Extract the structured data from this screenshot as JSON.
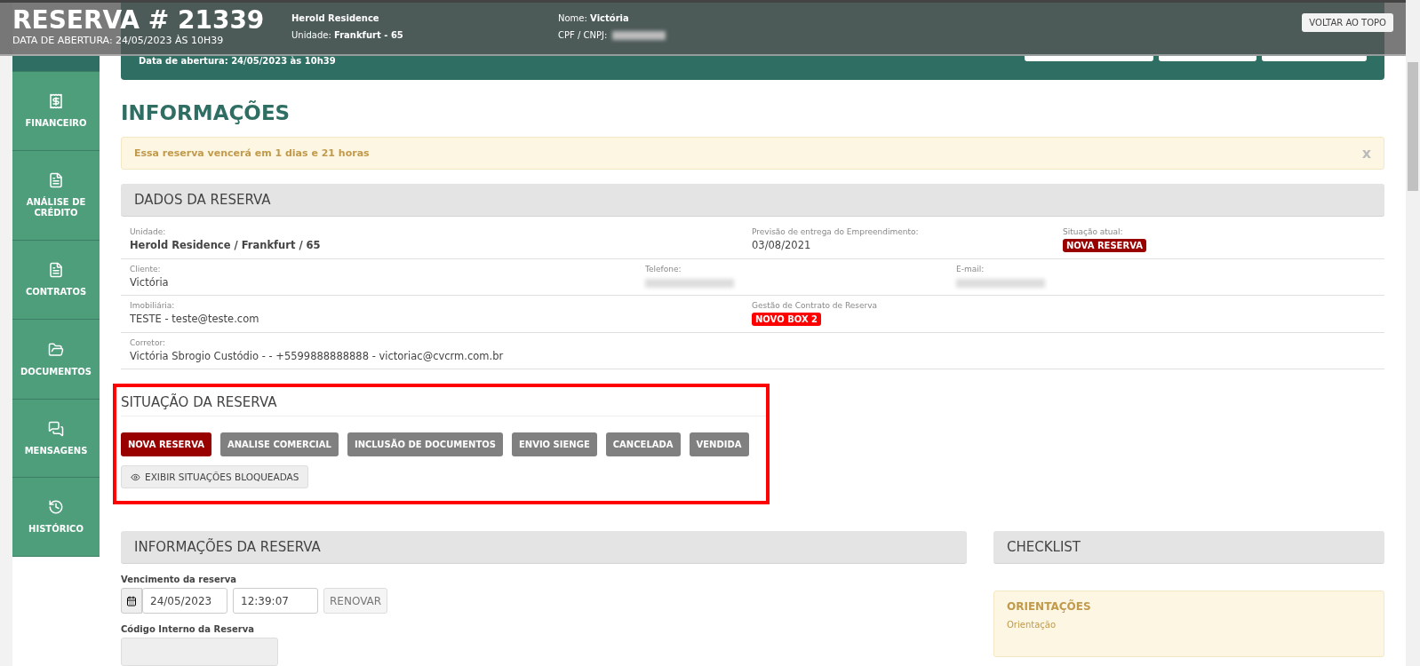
{
  "sticky_header": {
    "title": "RESERVA # 21339",
    "subtitle": "DATA DE ABERTURA: 24/05/2023 ÀS 10H39",
    "enterprise": "Herold Residence",
    "unit_label": "Unidade:",
    "unit": "Frankfurt - 65",
    "name_label": "Nome:",
    "name": "Victória",
    "doc_label": "CPF / CNPJ:",
    "back_button": "VOLTAR AO TOPO"
  },
  "sidebar": {
    "items": [
      {
        "selected": true
      },
      {
        "label": "FINANCEIRO",
        "selected": false
      },
      {
        "label": "ANÁLISE DE CRÉDITO",
        "selected": false
      },
      {
        "label": "CONTRATOS",
        "selected": false
      },
      {
        "label": "DOCUMENTOS",
        "selected": false
      },
      {
        "label": "MENSAGENS",
        "selected": false
      },
      {
        "label": "HISTÓRICO",
        "selected": false
      }
    ]
  },
  "page_header": {
    "opened": "Data de abertura: 24/05/2023 às 10h39"
  },
  "heading": "INFORMAÇÕES",
  "alert": {
    "text": "Essa reserva vencerá em 1 dias e 21 horas",
    "close": "x"
  },
  "reservation_data": {
    "title": "DADOS DA RESERVA",
    "rows": [
      {
        "fields": [
          {
            "label": "Unidade:",
            "value": "Herold Residence / Frankfurt / 65",
            "kind": "bold"
          },
          {
            "label": "Previsão de entrega do Empreendimento:",
            "value": "03/08/2021",
            "kind": "text"
          },
          {
            "label": "Situação atual:",
            "value": "NOVA RESERVA",
            "kind": "badge",
            "color": "#990000"
          }
        ]
      },
      {
        "fields": [
          {
            "label": "Cliente:",
            "value": "Victória",
            "kind": "text"
          },
          {
            "label": "Telefone:",
            "kind": "blurred"
          },
          {
            "label": "E-mail:",
            "kind": "blurred"
          }
        ]
      },
      {
        "fields": [
          {
            "label": "Imobiliária:",
            "value": "TESTE - teste@teste.com",
            "kind": "text"
          },
          {
            "label": "Gestão de Contrato de Reserva",
            "value": "NOVO BOX 2",
            "kind": "badge",
            "color": "#ff0000"
          }
        ]
      },
      {
        "fields": [
          {
            "label": "Corretor:",
            "value": "Victória Sbrogio Custódio - - +5599888888888 - victoriac@cvcrm.com.br",
            "kind": "text"
          }
        ]
      }
    ]
  },
  "status_section": {
    "title": "SITUAÇÃO DA RESERVA",
    "statuses": [
      {
        "label": "NOVA RESERVA",
        "selected": true
      },
      {
        "label": "ANALISE COMERCIAL",
        "selected": false
      },
      {
        "label": "INCLUSÃO DE DOCUMENTOS",
        "selected": false
      },
      {
        "label": "ENVIO SIENGE",
        "selected": false
      },
      {
        "label": "CANCELADA",
        "selected": false
      },
      {
        "label": "VENDIDA",
        "selected": false
      }
    ],
    "show_blocked": "EXIBIR SITUAÇÕES BLOQUEADAS"
  },
  "reservation_info": {
    "title": "INFORMAÇÕES DA RESERVA",
    "due_label": "Vencimento da reserva",
    "due_date": "24/05/2023",
    "due_time": "12:39:07",
    "renew": "RENOVAR",
    "code_label": "Código Interno da Reserva"
  },
  "checklist": {
    "title": "CHECKLIST",
    "guidance_title": "ORIENTAÇÕES",
    "guidance_text": "Orientação"
  }
}
